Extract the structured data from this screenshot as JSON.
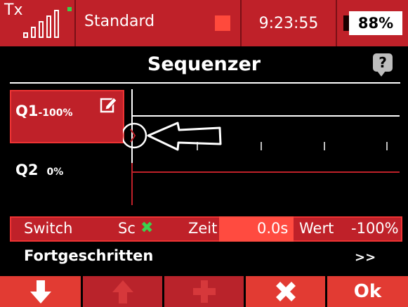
{
  "status_bar": {
    "tx_label": "Tx",
    "signal_icon": "signal-bars-icon",
    "model_name": "Standard",
    "time": "9:23:55",
    "battery_percent": "88%",
    "battery_level": 0.88
  },
  "title": "Sequenzer",
  "help_icon_text": "?",
  "sequences": [
    {
      "name": "Q1",
      "value": "-100%",
      "selected": true
    },
    {
      "name": "Q2",
      "value": "0%",
      "selected": false
    }
  ],
  "graph": {
    "ticks": [
      "1",
      "2",
      "3",
      "4"
    ]
  },
  "params": {
    "switch_label": "Switch",
    "switch_value": "Sc",
    "switch_state_icon": "x-mark-icon",
    "time_label": "Zeit",
    "time_value": "0.0s",
    "value_label": "Wert",
    "value_value": "-100%"
  },
  "advanced": {
    "label": "Fortgeschritten",
    "arrow": ">>"
  },
  "buttons": [
    {
      "name": "down",
      "icon": "arrow-down-icon"
    },
    {
      "name": "up",
      "icon": "arrow-up-icon"
    },
    {
      "name": "add",
      "icon": "plus-icon"
    },
    {
      "name": "delete",
      "icon": "x-icon"
    },
    {
      "name": "ok",
      "label": "Ok"
    }
  ],
  "colors": {
    "bar_red": "#bf2129",
    "button_red": "#e23b33",
    "highlight": "#ff4b40",
    "green": "#3bd24e"
  }
}
